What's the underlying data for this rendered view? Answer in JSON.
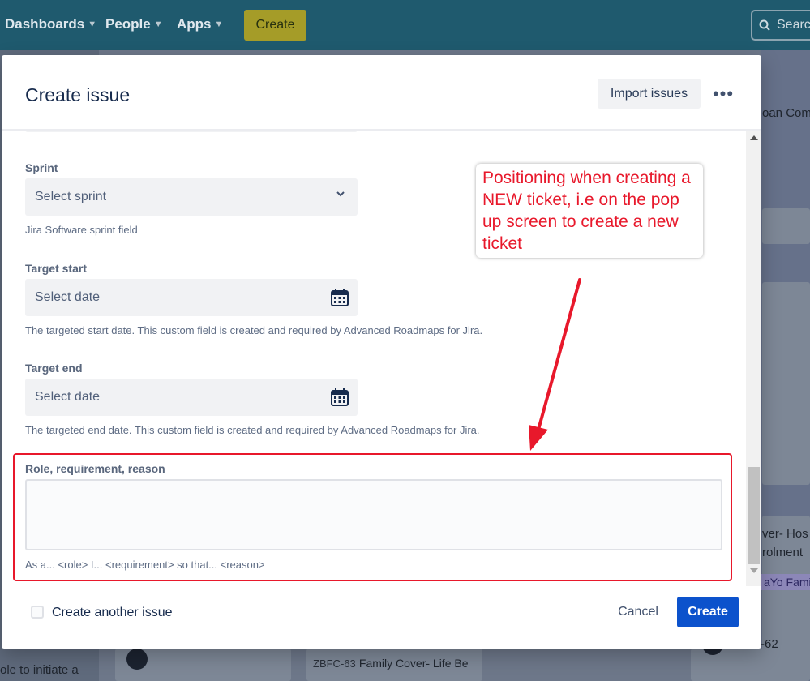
{
  "topnav": {
    "items": [
      "Dashboards",
      "People",
      "Apps"
    ],
    "create_label": "Create",
    "search_placeholder": "Search"
  },
  "background": {
    "texts": [
      "oan Com",
      "ver- Hos",
      "rolment",
      "aYo Fami",
      "-62",
      "ole to initiate a"
    ],
    "card_key": "ZBFC-63",
    "card_title": "Family Cover- Life Be"
  },
  "modal": {
    "title": "Create issue",
    "import_label": "Import issues",
    "more_label": "•••",
    "fields": {
      "sprint": {
        "label": "Sprint",
        "placeholder": "Select sprint",
        "help": "Jira Software sprint field"
      },
      "target_start": {
        "label": "Target start",
        "placeholder": "Select date",
        "help": "The targeted start date. This custom field is created and required by Advanced Roadmaps for Jira."
      },
      "target_end": {
        "label": "Target end",
        "placeholder": "Select date",
        "help": "The targeted end date. This custom field is created and required by Advanced Roadmaps for Jira."
      },
      "role_requirement": {
        "label": "Role, requirement, reason",
        "value": "",
        "help": "As a... <role> I... <requirement> so that... <reason>"
      }
    },
    "footer": {
      "checkbox_label": "Create another issue",
      "cancel_label": "Cancel",
      "create_label": "Create"
    }
  },
  "annotation": {
    "text": "Positioning when creating a NEW ticket, i.e on the pop up screen to create a new ticket",
    "color": "#e8182b"
  },
  "colors": {
    "primary_button": "#0c52cc",
    "nav_background": "#1f5a6e",
    "nav_create": "#a59c28"
  }
}
